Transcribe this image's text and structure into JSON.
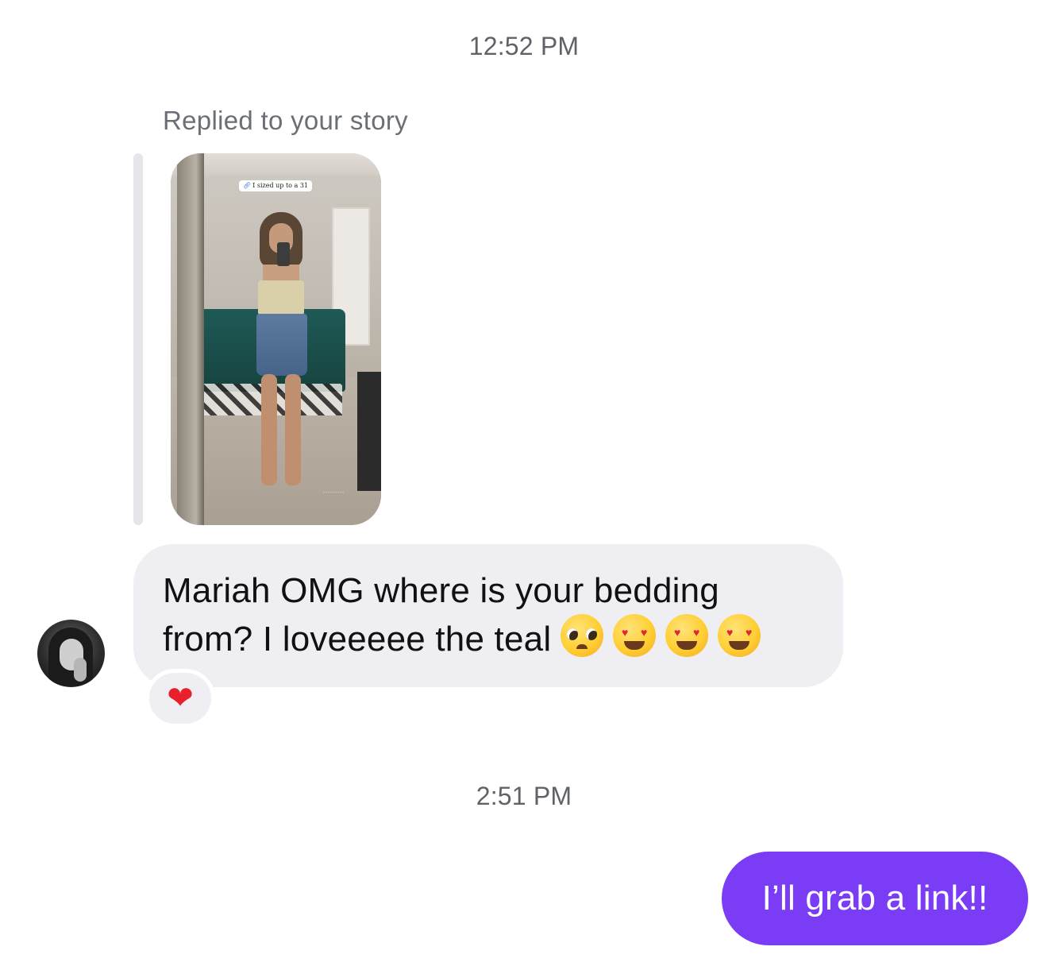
{
  "thread": {
    "timestamp_1": "12:52 PM",
    "timestamp_2": "2:51 PM"
  },
  "story_reply": {
    "label": "Replied to your story",
    "sticker_text": "I sized up to a 31",
    "sticker_icon": "link-icon"
  },
  "incoming": {
    "text_line_1": "Mariah OMG where is your bedding",
    "text_line_2": "from? I loveeeee the teal",
    "emojis": [
      "pleading-face-icon",
      "heart-eyes-icon",
      "heart-eyes-icon",
      "heart-eyes-icon"
    ],
    "reaction": "heart-icon"
  },
  "outgoing": {
    "text": "I’ll grab a link!!"
  },
  "colors": {
    "outgoing_bubble": "#7a3cf4",
    "incoming_bubble": "#efeff3",
    "reaction_heart": "#e8202c"
  }
}
